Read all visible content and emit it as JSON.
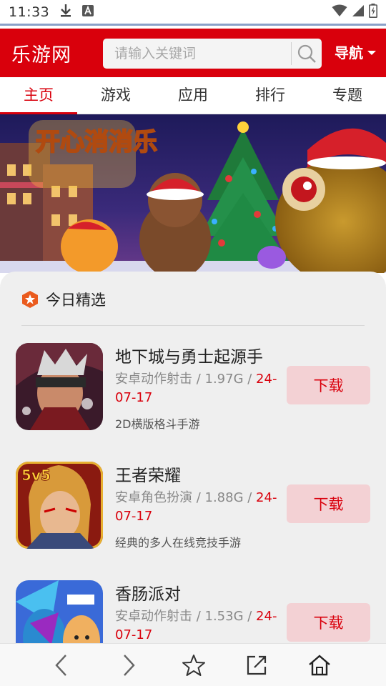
{
  "status_bar": {
    "time": "11:33",
    "icons_left": [
      "download-icon",
      "a-badge-icon"
    ],
    "icons_right": [
      "wifi-icon",
      "signal-icon",
      "battery-icon"
    ]
  },
  "header": {
    "logo": "乐游网",
    "search_placeholder": "请输入关键词",
    "nav_label": "导航"
  },
  "tabs": [
    {
      "label": "主页",
      "active": true
    },
    {
      "label": "游戏",
      "active": false
    },
    {
      "label": "应用",
      "active": false
    },
    {
      "label": "排行",
      "active": false
    },
    {
      "label": "专题",
      "active": false
    }
  ],
  "banner": {
    "title_art": "开心消消乐"
  },
  "section": {
    "title": "今日精选"
  },
  "apps": [
    {
      "name": "地下城与勇士起源手",
      "meta": "安卓动作射击 / 1.97G / ",
      "date": "24-07-17",
      "desc": "2D横版格斗手游",
      "download": "下载"
    },
    {
      "name": "王者荣耀",
      "meta": "安卓角色扮演 / 1.88G / ",
      "date": "24-07-17",
      "desc": "经典的多人在线竞技手游",
      "download": "下载",
      "icon_badge": "5v5"
    },
    {
      "name": "香肠派对",
      "meta": "安卓动作射击 / 1.53G / ",
      "date": "24-07-17",
      "desc": "",
      "download": "下载"
    }
  ],
  "bottom_nav": [
    "back-icon",
    "forward-icon",
    "bookmark-star-icon",
    "share-icon",
    "home-icon"
  ],
  "colors": {
    "brand_red": "#d9000c",
    "download_bg": "#f3d1d4",
    "content_bg": "#efefef"
  }
}
